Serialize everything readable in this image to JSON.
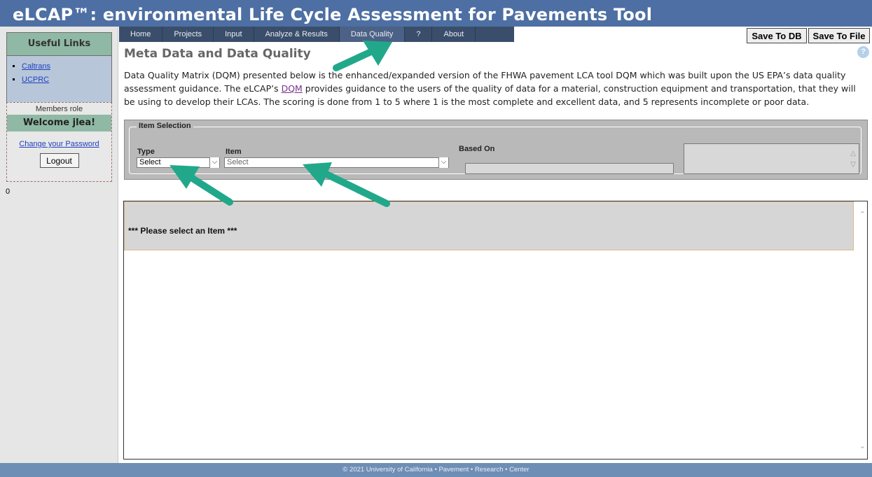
{
  "app": {
    "title": "eLCAP™: environmental Life Cycle Assessment for Pavements Tool"
  },
  "sidebar": {
    "useful_links_title": "Useful Links",
    "links": [
      {
        "label": "Caltrans"
      },
      {
        "label": "UCPRC"
      }
    ],
    "members_role": "Members role",
    "welcome": "Welcome jlea!",
    "change_password": "Change your Password",
    "logout": "Logout",
    "counter": "0"
  },
  "nav": {
    "items": [
      {
        "label": "Home"
      },
      {
        "label": "Projects"
      },
      {
        "label": "Input"
      },
      {
        "label": "Analyze & Results"
      },
      {
        "label": "Data Quality"
      },
      {
        "label": "?"
      },
      {
        "label": "About"
      }
    ],
    "active": "Data Quality",
    "save_db": "Save To DB",
    "save_file": "Save To File"
  },
  "help_icon": "?",
  "page": {
    "title": "Meta Data and Data Quality",
    "desc_part1": "Data Quality Matrix (DQM) presented below is the enhanced/expanded version of the FHWA pavement LCA tool DQM which was built upon the US EPA’s data quality assessment guidance. The eLCAP’s ",
    "desc_link": "DQM",
    "desc_part2": " provides guidance to the users of the quality of data for a material, construction equipment and transportation, that they will be using to develop their LCAs. The scoring is done from 1 to 5 where 1 is the most complete and excellent data, and 5 represents incomplete or poor data."
  },
  "selection": {
    "legend": "Item Selection",
    "type_label": "Type",
    "type_value": "Select",
    "item_label": "Item",
    "item_value": "Select",
    "based_on_label": "Based On"
  },
  "result": {
    "message": "*** Please select an Item ***"
  },
  "footer": {
    "text": "© 2021 University of California • Pavement • Research • Center"
  },
  "colors": {
    "title_bar": "#4d6fa3",
    "nav_bar": "#3a4e6b",
    "sidebar_header": "#8fb8a5",
    "annotation_arrow": "#21a88b",
    "footer": "#6f8eb5"
  }
}
